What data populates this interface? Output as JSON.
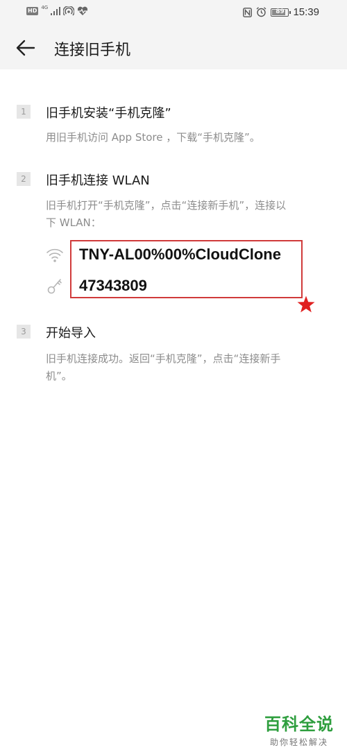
{
  "status_bar": {
    "hd_badge": "HD",
    "network_label": "4G",
    "battery_level": 89,
    "time": "15:39"
  },
  "app_bar": {
    "title": "连接旧手机"
  },
  "steps": [
    {
      "number": "1",
      "title": "旧手机安装“手机克隆”",
      "description": "用旧手机访问 App Store ，下载“手机克隆”。"
    },
    {
      "number": "2",
      "title": "旧手机连接 WLAN",
      "description_line1": "旧手机打开“手机克隆”，点击“连接新手机”，连接以",
      "description_line2": "下 WLAN："
    },
    {
      "number": "3",
      "title": "开始导入",
      "description_line1": "旧手机连接成功。返回“手机克隆”，点击“连接新手",
      "description_line2": "机”。"
    }
  ],
  "wlan": {
    "ssid": "TNY-AL00%00%CloudClone",
    "password": "47343809",
    "ssid_icon": "wifi-icon",
    "password_icon": "key-icon"
  },
  "annotation": {
    "box_color": "#d03a3a",
    "star_color": "#e02020"
  },
  "watermark": {
    "main": "百科全说",
    "sub": "助你轻松解决",
    "color": "#2e9e3e"
  }
}
